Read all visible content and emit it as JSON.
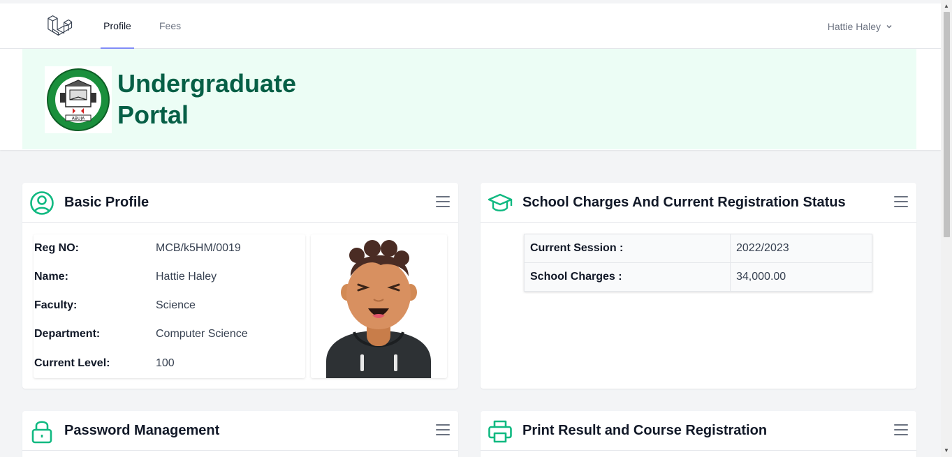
{
  "nav": {
    "logo": "laravel-logo-icon",
    "links": [
      {
        "label": "Profile",
        "active": true
      },
      {
        "label": "Fees",
        "active": false
      }
    ],
    "user_name": "Hattie Haley"
  },
  "header": {
    "title_line1": "Undergraduate",
    "title_line2": "Portal",
    "crest_icon": "university-crest-icon"
  },
  "basic_profile": {
    "title": "Basic Profile",
    "rows": [
      {
        "label": "Reg NO:",
        "value": "MCB/k5HM/0019"
      },
      {
        "label": "Name:",
        "value": "Hattie Haley"
      },
      {
        "label": "Faculty:",
        "value": "Science"
      },
      {
        "label": "Department:",
        "value": "Computer Science"
      },
      {
        "label": "Current Level:",
        "value": "100"
      }
    ]
  },
  "school_charges": {
    "title": "School Charges And Current Registration Status",
    "rows": [
      {
        "label": "Current Session :",
        "value": "2022/2023"
      },
      {
        "label": "School Charges :",
        "value": "34,000.00"
      }
    ]
  },
  "password_management": {
    "title": "Password Management"
  },
  "print_result": {
    "title": "Print Result and Course Registration"
  },
  "colors": {
    "accent_green": "#10b981",
    "title_green": "#065f46",
    "header_bg": "#ecfdf5",
    "active_tab_underline": "#818cf8"
  }
}
